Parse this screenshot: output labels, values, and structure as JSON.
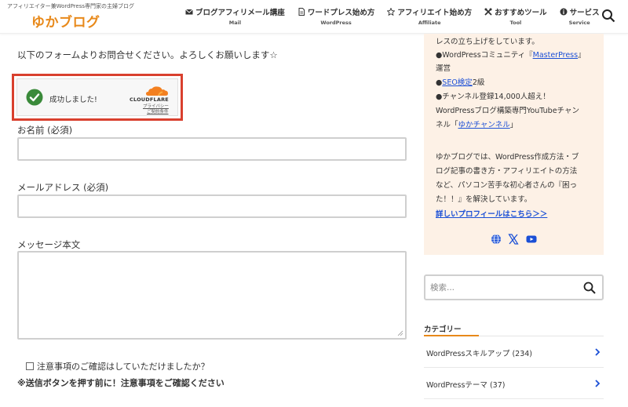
{
  "header": {
    "tagline": "アフィリエイター兼WordPress専門家の主婦ブログ",
    "logo": "ゆかブログ",
    "nav": [
      {
        "label": "ブログアフィリメール講座",
        "sub": "Mail",
        "icon": "envelope-icon"
      },
      {
        "label": "ワードプレス始め方",
        "sub": "WordPress",
        "icon": "document-icon"
      },
      {
        "label": "アフィリエイト始め方",
        "sub": "Affiliate",
        "icon": "star-icon"
      },
      {
        "label": "おすすめツール",
        "sub": "Tool",
        "icon": "tools-icon"
      },
      {
        "label": "サービス",
        "sub": "Service",
        "icon": "info-icon"
      }
    ]
  },
  "main": {
    "intro": "以下のフォームよりお問合せください。よろしくお願いします☆",
    "turnstile": {
      "status": "成功しました!",
      "brand": "CLOUDFLARE",
      "privacy": "プライバシー",
      "terms": "ご契約条件"
    },
    "form": {
      "name_label": "お名前 (必須)",
      "email_label": "メールアドレス (必須)",
      "message_label": "メッセージ本文",
      "confirm_label": "注意事項のご確認はしていただけましたか？",
      "warning": "※送信ボタンを押す前に！注意事項をご確認ください"
    }
  },
  "sidebar": {
    "profile": {
      "line1": "レスの立ち上げをしています。",
      "line2_pre": "●WordPressコミュニティ『",
      "line2_link": "MasterPress",
      "line2_post": "』",
      "line3": "運営",
      "line4_pre": "●",
      "line4_link": "SEO検定",
      "line4_post": "2級",
      "line5": "●チャンネル登録14,000人超え！",
      "line6": "WordPressブログ構築専門YouTubeチャン",
      "line7_pre": "ネル「",
      "line7_link": "ゆかチャンネル",
      "line7_post": "」",
      "line8": "ゆかブログでは、WordPress作成方法・ブ",
      "line9": "ログ記事の書き方・アフィリエイトの方法",
      "line10": "など、パソコン苦手な初心者さんの『困っ",
      "line11": "た！！』を解決しています。",
      "more_link": "詳しいプロフィールはこちら＞＞"
    },
    "search_placeholder": "検索...",
    "category_heading": "カテゴリー",
    "categories": [
      {
        "label": "WordPressスキルアップ (234)"
      },
      {
        "label": "WordPressテーマ (37)"
      }
    ]
  },
  "colors": {
    "accent": "#e8891a",
    "highlight_border": "#d9402e",
    "success": "#3a8a3a",
    "link": "#1a4fd6",
    "profile_bg": "#fdf1e6"
  }
}
